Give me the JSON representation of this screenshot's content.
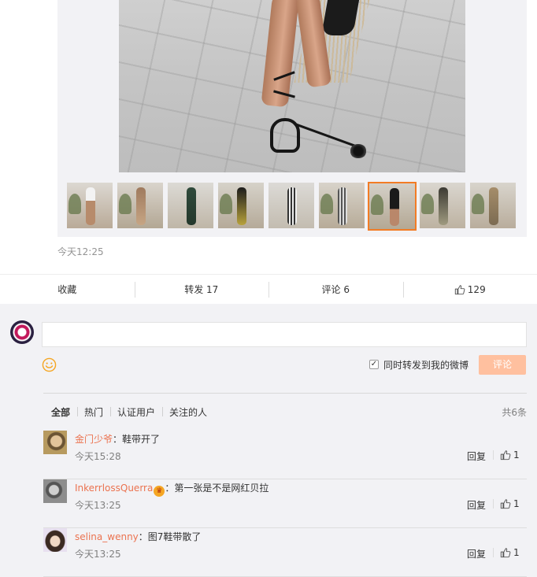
{
  "post": {
    "timestamp": "今天12:25"
  },
  "thumbnails": {
    "count": 9,
    "active_index": 6,
    "accent_color": "#f27c25"
  },
  "actions": {
    "favorite": "收藏",
    "forward": "转发 17",
    "comment": "评论 6",
    "like_count": "129"
  },
  "composer": {
    "placeholder": "",
    "forward_to_weibo": "同时转发到我的微博",
    "forward_checked": true,
    "submit": "评论",
    "submit_color": "#ffc09f"
  },
  "filters": {
    "tabs": [
      "全部",
      "热门",
      "认证用户",
      "关注的人"
    ],
    "active": "全部",
    "total": "共6条"
  },
  "comments": [
    {
      "user": "金门少爷",
      "sep": "：",
      "text": "鞋带开了",
      "time": "今天15:28",
      "reply": "回复",
      "likes": "1"
    },
    {
      "user": "InkerrlossQuerra",
      "sep": "：",
      "text": "第一张是不是网红贝拉",
      "time": "今天13:25",
      "reply": "回复",
      "likes": "1",
      "badge": "crown-icon"
    },
    {
      "user": "selina_wenny",
      "sep": "：",
      "text": "图7鞋带散了",
      "time": "今天13:25",
      "reply": "回复",
      "likes": "1"
    }
  ],
  "colors": {
    "username": "#eb7350",
    "page_bg": "#f2f2f5"
  }
}
